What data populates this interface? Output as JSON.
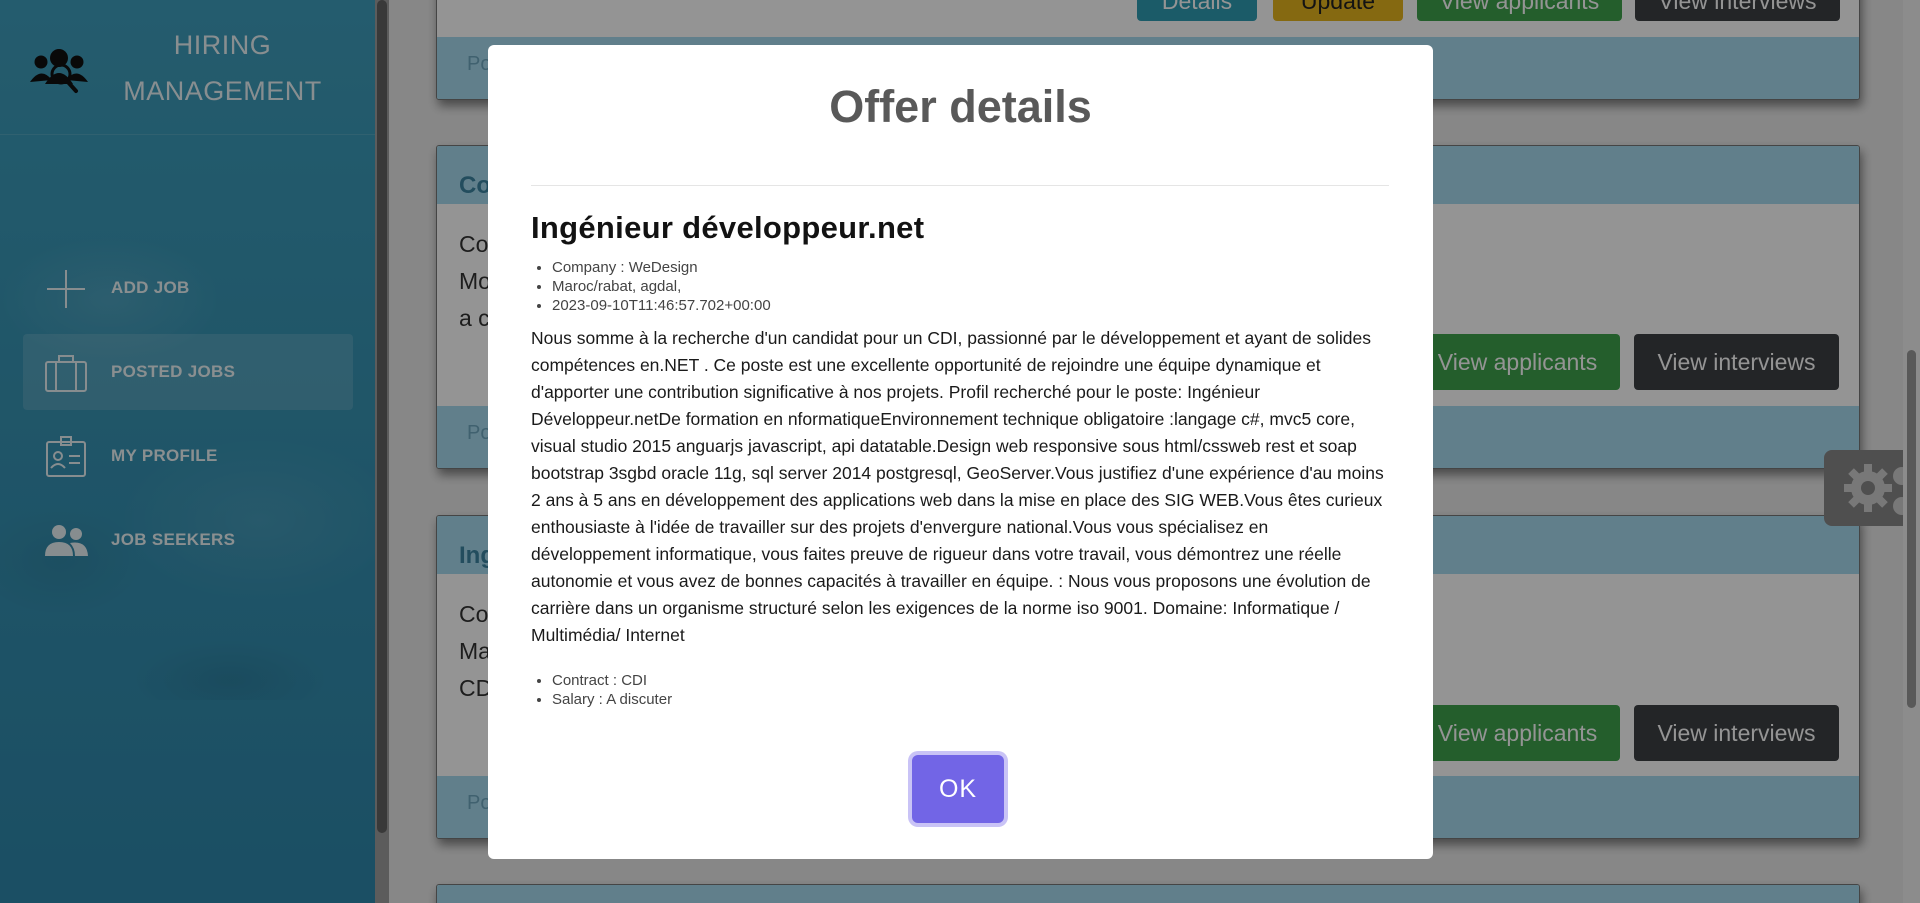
{
  "sidebar": {
    "brand": {
      "line1": "HIRING",
      "line2": "MANAGEMENT"
    },
    "nav": [
      {
        "label": "ADD JOB",
        "icon": "plus-icon"
      },
      {
        "label": "POSTED JOBS",
        "icon": "briefcase-icon",
        "active": true
      },
      {
        "label": "MY PROFILE",
        "icon": "id-badge-icon"
      },
      {
        "label": "JOB SEEKERS",
        "icon": "users-icon"
      }
    ]
  },
  "background": {
    "cards": [
      {
        "heading": "",
        "footer": "Po",
        "buttons": [
          "Details",
          "Update",
          "View applicants",
          "View interviews"
        ]
      },
      {
        "heading": "Co",
        "body": [
          "Co",
          "Mo",
          "a c"
        ],
        "footer": "Po",
        "buttons": [
          "View applicants",
          "View interviews"
        ]
      },
      {
        "heading": "Ing",
        "body": [
          "Co",
          "Ma",
          "CD"
        ],
        "footer": "Po",
        "buttons": [
          "View applicants",
          "View interviews"
        ]
      }
    ]
  },
  "modal": {
    "title": "Offer details",
    "job_title": "Ingénieur développeur.net",
    "meta": [
      "Company : WeDesign",
      "Maroc/rabat, agdal,",
      "2023-09-10T11:46:57.702+00:00"
    ],
    "description": "Nous somme à la recherche d'un candidat pour un CDI, passionné par le développement et ayant de solides compétences en.NET . Ce poste est une excellente opportunité de rejoindre une équipe dynamique et d'apporter une contribution significative à nos projets. Profil recherché pour le poste: Ingénieur Développeur.netDe formation en nformatiqueEnvironnement technique obligatoire :langage c#, mvc5 core, visual studio 2015 anguarjs javascript, api datatable.Design web responsive sous html/cssweb rest et soap bootstrap 3sgbd oracle 11g, sql server 2014 postgresql, GeoServer.Vous justifiez d'une expérience d'au moins 2 ans à 5 ans en développement des applications web dans la mise en place des SIG WEB.Vous êtes curieux enthousiaste à l'idée de travailler sur des projets d'envergure national.Vous vous spécialisez en développement informatique, vous faites preuve de rigueur dans votre travail, vous démontrez une réelle autonomie et vous avez de bonnes capacités à travailler en équipe. : Nous vous proposons une évolution de carrière dans un organisme structuré selon les exigences de la norme iso 9001. Domaine: Informatique / Multimédia/ Internet",
    "details": [
      "Contract : CDI",
      "Salary : A discuter"
    ],
    "ok_label": "OK"
  },
  "colors": {
    "sidebar": "#3794b4",
    "card_header": "#a8dbef",
    "ok_button": "#7265e6",
    "green_button": "#3ea34d",
    "dark_button": "#3d4044"
  }
}
